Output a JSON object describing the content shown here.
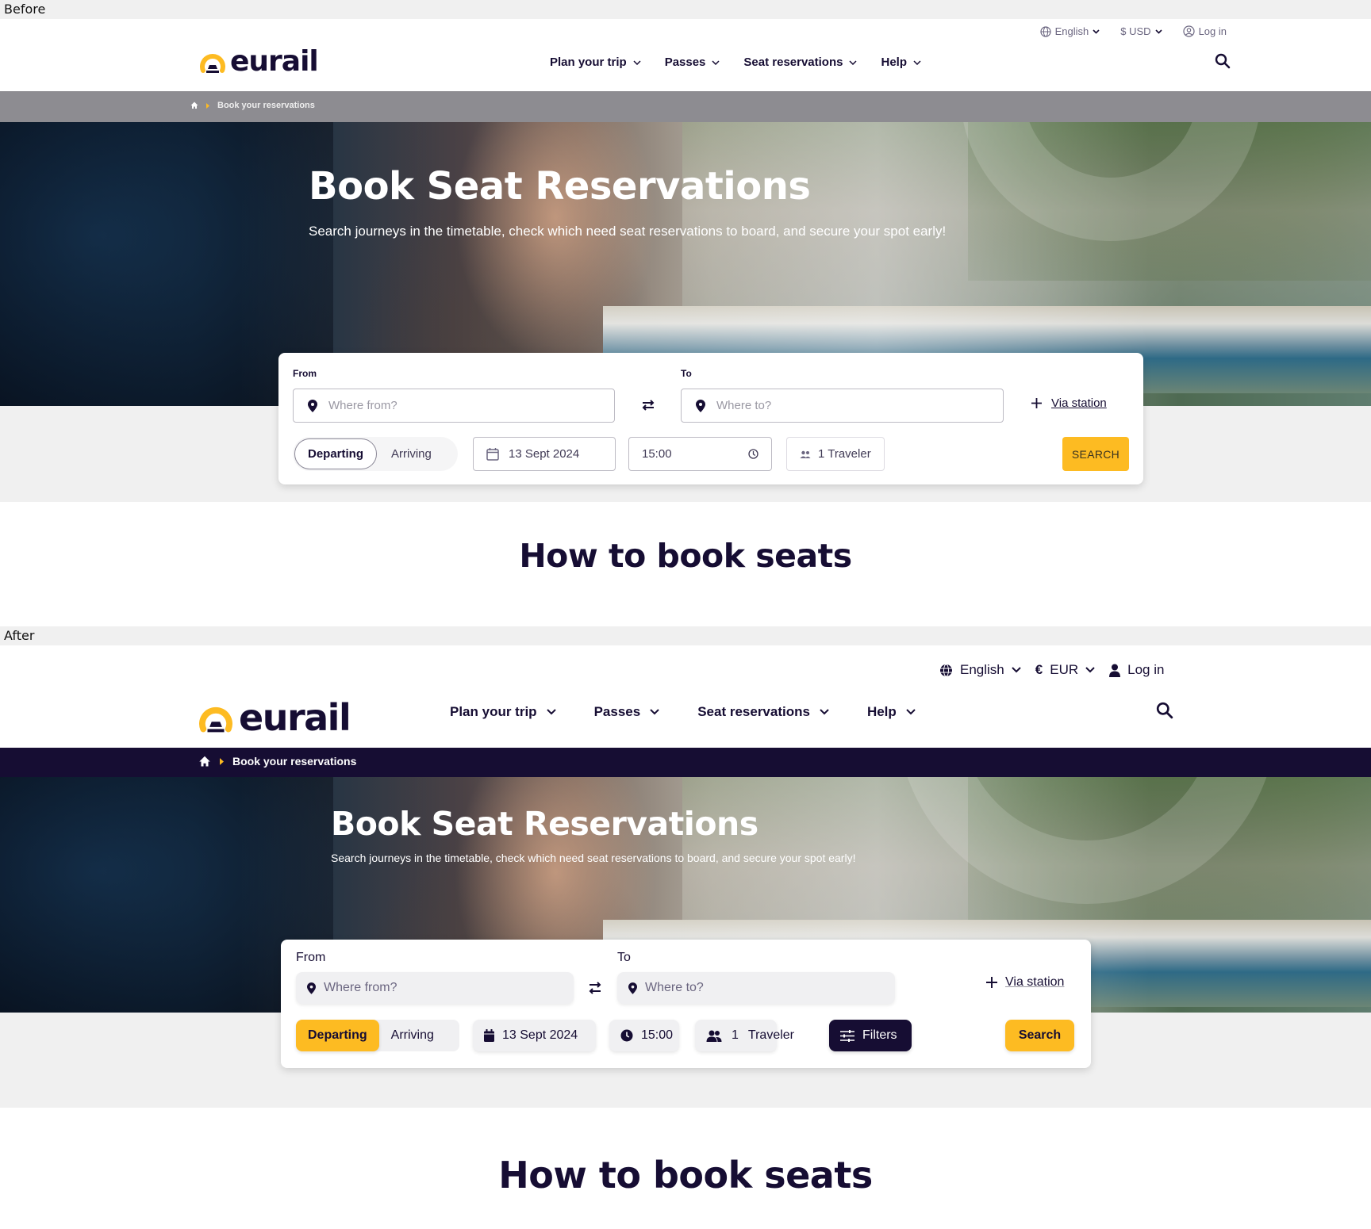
{
  "before": {
    "label": "Before",
    "header": {
      "logo_text": "eurail",
      "utility": {
        "language": "English",
        "currency": "$ USD",
        "login": "Log in"
      },
      "nav": [
        {
          "label": "Plan your trip"
        },
        {
          "label": "Passes"
        },
        {
          "label": "Seat reservations"
        },
        {
          "label": "Help"
        }
      ]
    },
    "breadcrumb": {
      "current": "Book your reservations"
    },
    "hero": {
      "title": "Book Seat Reservations",
      "subtitle": "Search journeys in the timetable, check which need seat reservations to board, and secure your spot early!"
    },
    "search_form": {
      "from_label": "From",
      "from_placeholder": "Where from?",
      "to_label": "To",
      "to_placeholder": "Where to?",
      "via_station": "Via station",
      "toggle": {
        "active": "Departing",
        "inactive": "Arriving"
      },
      "date": "13 Sept 2024",
      "time": "15:00",
      "travelers": "1 Traveler",
      "search_button": "SEARCH"
    },
    "section_title": "How to book seats"
  },
  "after": {
    "label": "After",
    "header": {
      "logo_text": "eurail",
      "utility": {
        "language": "English",
        "currency": "EUR",
        "login": "Log in"
      },
      "nav": [
        {
          "label": "Plan your trip"
        },
        {
          "label": "Passes"
        },
        {
          "label": "Seat reservations"
        },
        {
          "label": "Help"
        }
      ]
    },
    "breadcrumb": {
      "current": "Book your reservations"
    },
    "hero": {
      "title": "Book Seat Reservations",
      "subtitle": "Search journeys in the timetable, check which need seat reservations to board, and secure your spot early!"
    },
    "search_form": {
      "from_label": "From",
      "from_placeholder": "Where from?",
      "to_label": "To",
      "to_placeholder": "Where to?",
      "via_station": "Via station",
      "toggle": {
        "active": "Departing",
        "inactive": "Arriving"
      },
      "date": "13 Sept 2024",
      "time": "15:00",
      "travelers_count": "1",
      "travelers_label": "Traveler",
      "filters_button": "Filters",
      "search_button": "Search"
    },
    "section_title": "How to book seats"
  },
  "colors": {
    "brand_navy": "#160d33",
    "brand_yellow": "#fdbb22",
    "before_breadcrumb_bg": "#8d8c91",
    "section_bg": "#f0f0f0"
  }
}
